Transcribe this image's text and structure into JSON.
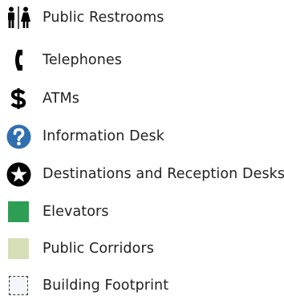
{
  "legend": {
    "items": [
      {
        "label": "Public Restrooms",
        "icon": "restroom-icon"
      },
      {
        "label": "Telephones",
        "icon": "telephone-icon"
      },
      {
        "label": "ATMs",
        "icon": "dollar-icon"
      },
      {
        "label": "Information Desk",
        "icon": "information-icon"
      },
      {
        "label": "Destinations and Reception Desks",
        "icon": "star-icon"
      },
      {
        "label": "Elevators",
        "icon": "elevator-swatch",
        "color": "#2e9e54"
      },
      {
        "label": "Public Corridors",
        "icon": "corridor-swatch",
        "color": "#d4dfb8"
      },
      {
        "label": "Building Footprint",
        "icon": "footprint-swatch",
        "color": "#f4f6fb"
      }
    ]
  },
  "colors": {
    "info_blue": "#2f6fb0",
    "icon_black": "#000000",
    "elevator_green": "#2e9e54",
    "corridor_green": "#d4dfb8"
  }
}
